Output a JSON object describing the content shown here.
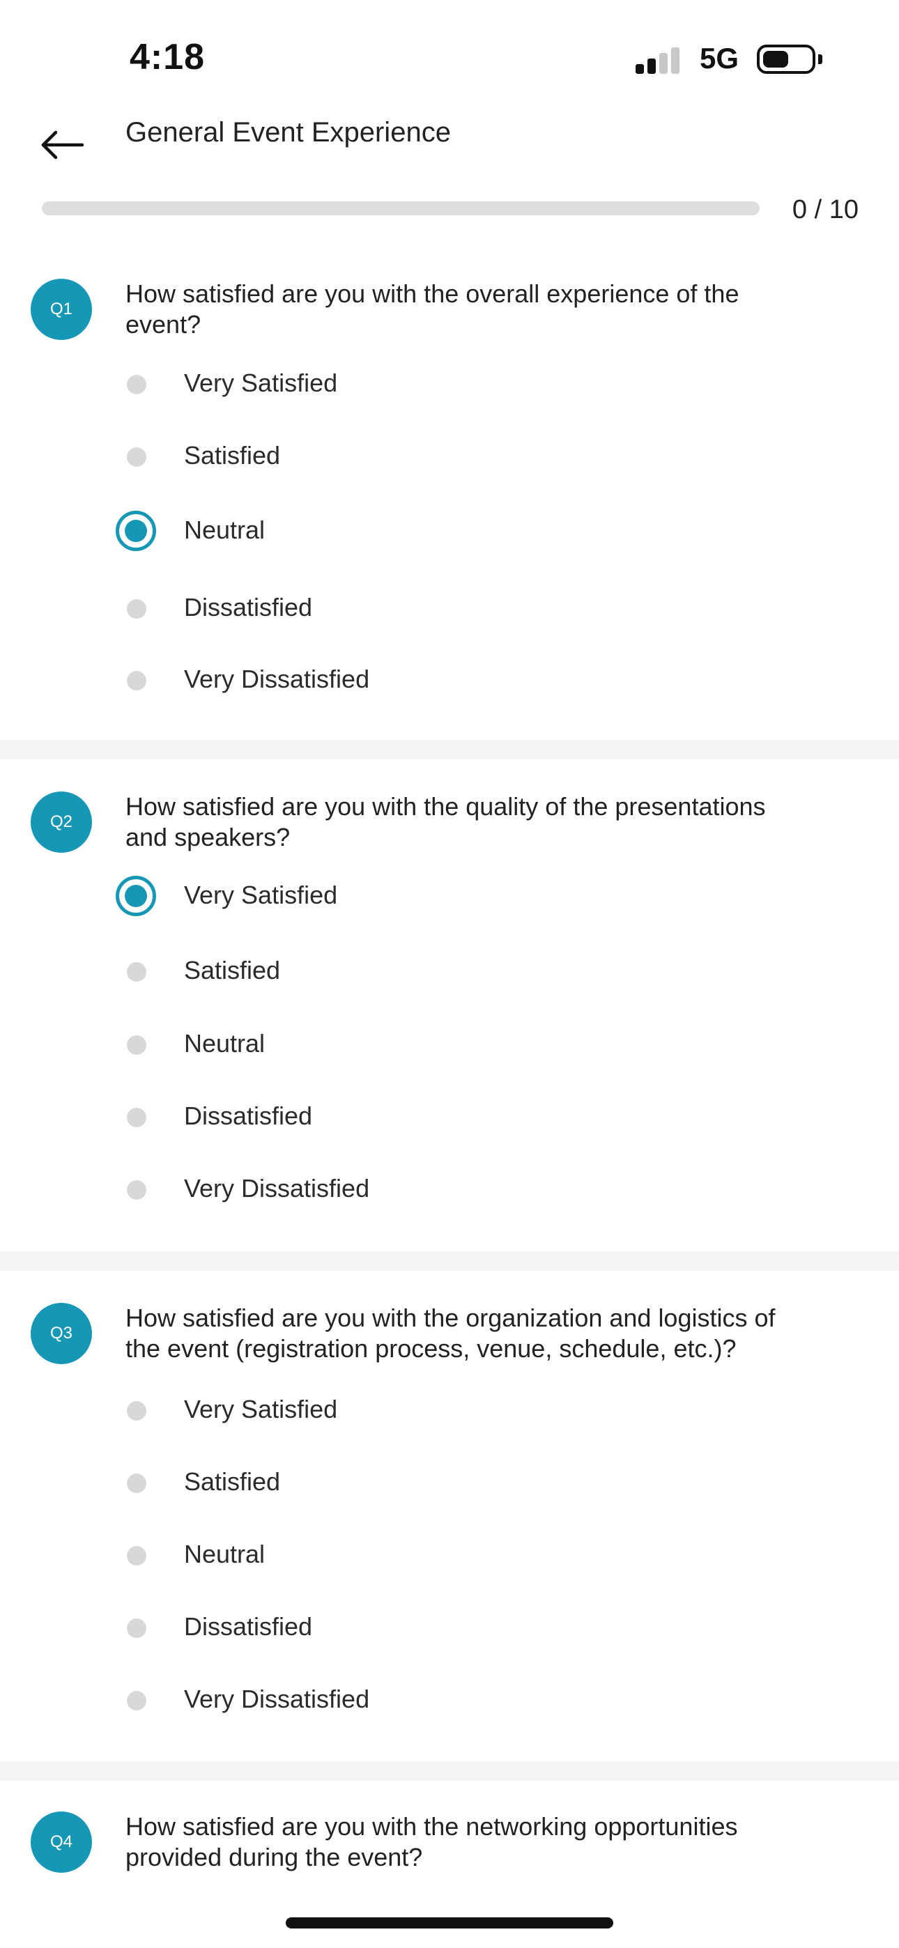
{
  "status_bar": {
    "time": "4:18",
    "network": "5G"
  },
  "header": {
    "title": "General Event Experience",
    "back_icon": "arrow-left-icon"
  },
  "progress": {
    "label": "0 / 10",
    "answered": 0,
    "total": 10,
    "fraction": 0
  },
  "colors": {
    "accent": "#1797b6",
    "unselected": "#d8d8d8",
    "separator": "#f5f5f5"
  },
  "questions": [
    {
      "badge": "Q1",
      "lines": [
        "How satisfied are you with the overall experience of the",
        "event?"
      ],
      "options": [
        "Very Satisfied",
        "Satisfied",
        "Neutral",
        "Dissatisfied",
        "Very Dissatisfied"
      ],
      "selected": 2
    },
    {
      "badge": "Q2",
      "lines": [
        "How satisfied are you with the quality of the presentations",
        "and speakers?"
      ],
      "options": [
        "Very Satisfied",
        "Satisfied",
        "Neutral",
        "Dissatisfied",
        "Very Dissatisfied"
      ],
      "selected": 0
    },
    {
      "badge": "Q3",
      "lines": [
        "How satisfied are you with the organization and logistics of",
        "the event (registration process, venue, schedule, etc.)?"
      ],
      "options": [
        "Very Satisfied",
        "Satisfied",
        "Neutral",
        "Dissatisfied",
        "Very Dissatisfied"
      ],
      "selected": null
    },
    {
      "badge": "Q4",
      "lines": [
        "How satisfied are you with the networking opportunities",
        "provided during the event?"
      ],
      "options": [],
      "selected": null
    }
  ]
}
